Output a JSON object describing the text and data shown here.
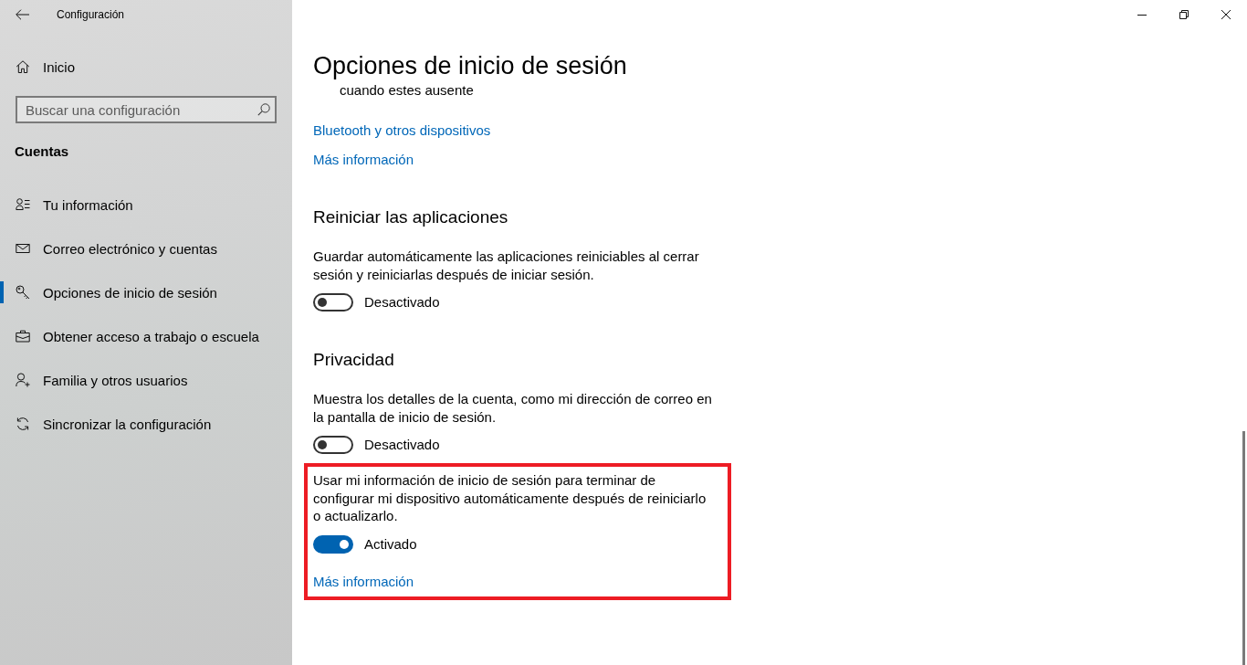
{
  "window": {
    "title": "Configuración"
  },
  "sidebar": {
    "home": "Inicio",
    "search": {
      "placeholder": "Buscar una configuración"
    },
    "section_title": "Cuentas",
    "items": [
      {
        "label": "Tu información",
        "selected": false
      },
      {
        "label": "Correo electrónico y cuentas",
        "selected": false
      },
      {
        "label": "Opciones de inicio de sesión",
        "selected": true
      },
      {
        "label": "Obtener acceso a trabajo o escuela",
        "selected": false
      },
      {
        "label": "Familia y otros usuarios",
        "selected": false
      },
      {
        "label": "Sincronizar la configuración",
        "selected": false
      }
    ]
  },
  "page": {
    "title": "Opciones de inicio de sesión",
    "partial_text": "cuando estes ausente",
    "links": [
      "Bluetooth y otros dispositivos",
      "Más información"
    ],
    "sections": [
      {
        "heading": "Reiniciar las aplicaciones",
        "settings": [
          {
            "description": "Guardar automáticamente las aplicaciones reiniciables al cerrar sesión y reiniciarlas después de iniciar sesión.",
            "on": false,
            "state_label": "Desactivado",
            "highlighted": false
          }
        ]
      },
      {
        "heading": "Privacidad",
        "settings": [
          {
            "description": "Muestra los detalles de la cuenta, como mi dirección de correo en la pantalla de inicio de sesión.",
            "on": false,
            "state_label": "Desactivado",
            "highlighted": false
          },
          {
            "description": "Usar mi información de inicio de sesión para terminar de configurar mi dispositivo automáticamente después de reiniciarlo o actualizarlo.",
            "on": true,
            "state_label": "Activado",
            "highlighted": true,
            "link": "Más información"
          }
        ]
      }
    ]
  }
}
